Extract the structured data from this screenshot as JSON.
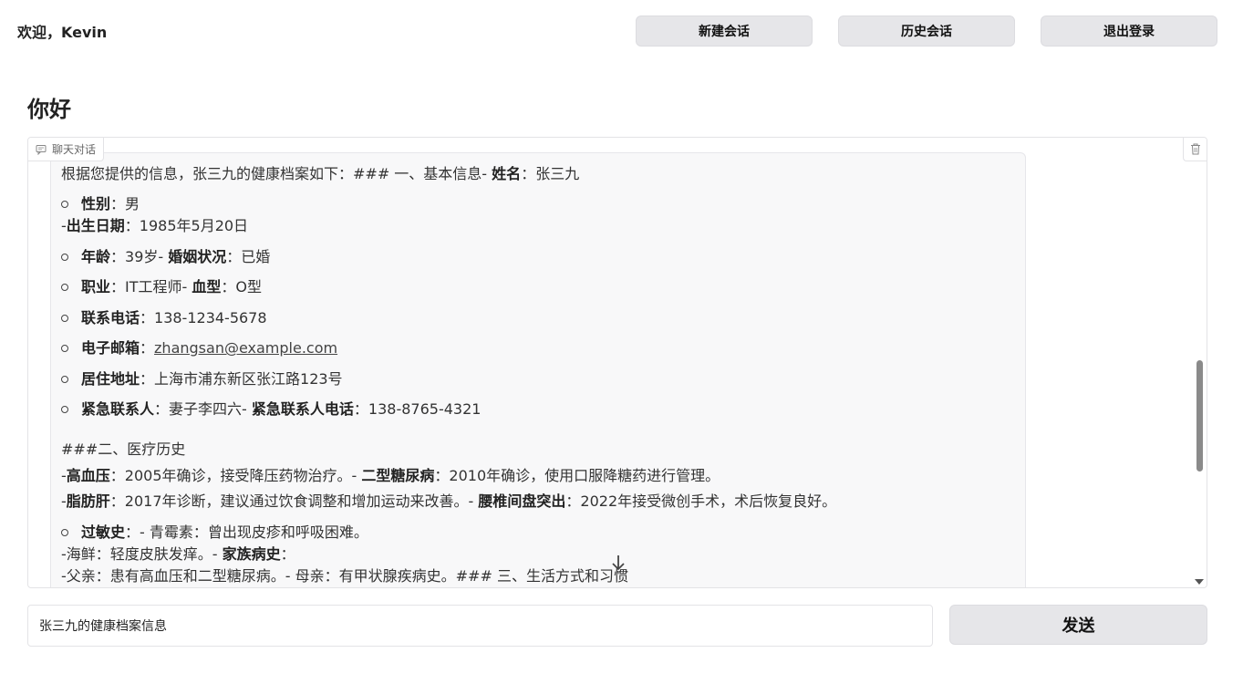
{
  "header": {
    "welcome_prefix": "欢迎，",
    "username": "Kevin",
    "new_chat": "新建会话",
    "history_chat": "历史会话",
    "logout": "退出登录"
  },
  "page_title": "你好",
  "chat": {
    "label": "聊天对话",
    "lines": {
      "l1_a": "根据您提供的信息，张三九的健康档案如下：### 一、基本信息- ",
      "l1_b": "姓名",
      "l1_c": "：张三九",
      "l2_b": "性别",
      "l2_c": "：男",
      "l3_a": "-",
      "l3_b": "出生日期",
      "l3_c": "：1985年5月20日",
      "l4_b": "年龄",
      "l4_c": "：39岁- ",
      "l4_d": "婚姻状况",
      "l4_e": "：已婚",
      "l5_b": "职业",
      "l5_c": "：IT工程师- ",
      "l5_d": "血型",
      "l5_e": "：O型",
      "l6_b": "联系电话",
      "l6_c": "：138-1234-5678",
      "l7_b": "电子邮箱",
      "l7_c": "：",
      "l7_d": "zhangsan@example.com",
      "l8_b": "居住地址",
      "l8_c": "：上海市浦东新区张江路123号",
      "l9_b": "紧急联系人",
      "l9_c": "：妻子李四六- ",
      "l9_d": "紧急联系人电话",
      "l9_e": "：138-8765-4321",
      "l10": "###二、医疗历史",
      "l11_a": "-",
      "l11_b": "高血压",
      "l11_c": "：2005年确诊，接受降压药物治疗。- ",
      "l11_d": "二型糖尿病",
      "l11_e": "：2010年确诊，使用口服降糖药进行管理。",
      "l12_a": "-",
      "l12_b": "脂肪肝",
      "l12_c": "：2017年诊断，建议通过饮食调整和增加运动来改善。- ",
      "l12_d": "腰椎间盘突出",
      "l12_e": "：2022年接受微创手术，术后恢复良好。",
      "l13_b": "过敏史",
      "l13_c": "：- 青霉素：曾出现皮疹和呼吸困难。",
      "l14_a": "-海鲜：轻度皮肤发痒。- ",
      "l14_b": "家族病史",
      "l14_c": "：",
      "l15": "-父亲：患有高血压和二型糖尿病。- 母亲：有甲状腺疾病史。### 三、生活方式和习惯"
    }
  },
  "input": {
    "value": "张三九的健康档案信息"
  },
  "send": "发送"
}
